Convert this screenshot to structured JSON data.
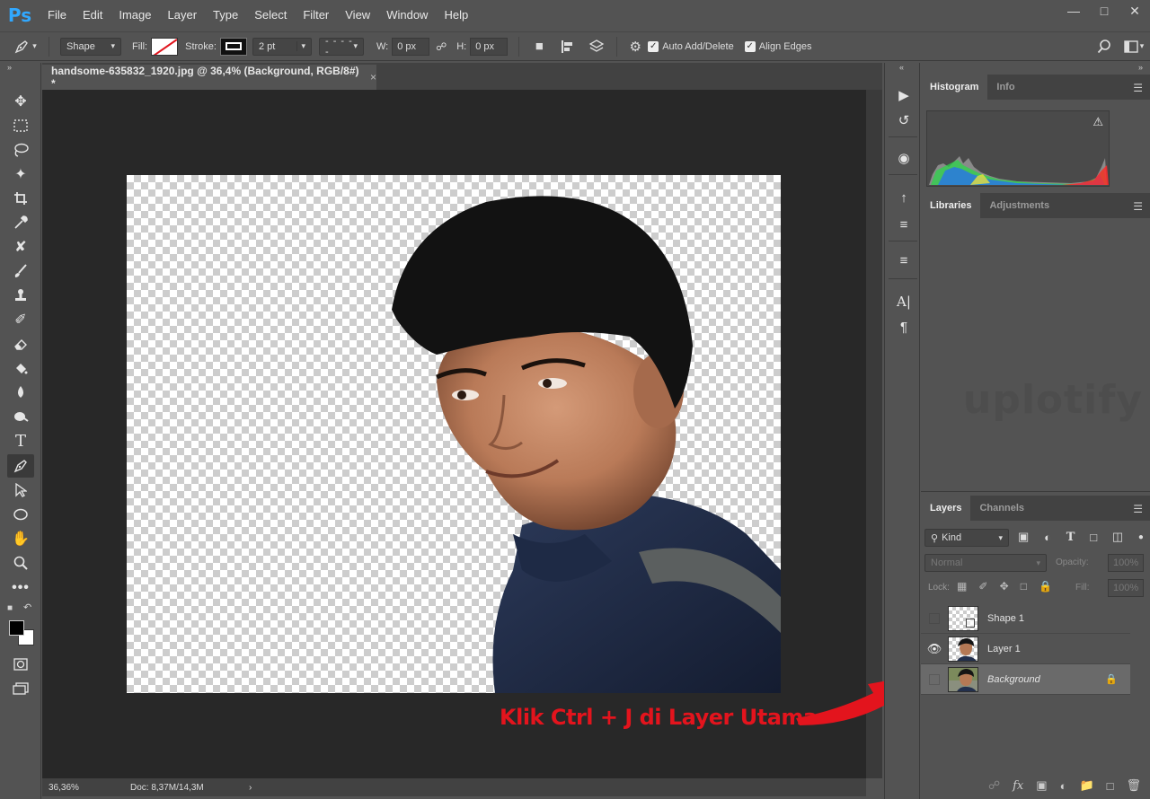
{
  "app": {
    "logo": "Ps"
  },
  "menu": [
    "File",
    "Edit",
    "Image",
    "Layer",
    "Type",
    "Select",
    "Filter",
    "View",
    "Window",
    "Help"
  ],
  "window_controls": [
    "minimize",
    "restore",
    "close"
  ],
  "options": {
    "mode": "Shape",
    "fill_label": "Fill:",
    "stroke_label": "Stroke:",
    "stroke_width": "2 pt",
    "w_label": "W:",
    "w_value": "0 px",
    "h_label": "H:",
    "h_value": "0 px",
    "auto_add_delete": "Auto Add/Delete",
    "align_edges": "Align Edges",
    "auto_add_checked": true,
    "align_edges_checked": true
  },
  "document": {
    "tab_title": "handsome-635832_1920.jpg @ 36,4% (Background, RGB/8#) *",
    "close": "×",
    "zoom": "36,36%",
    "doc_info": "Doc: 8,37M/14,3M",
    "status_arrow": "›"
  },
  "tools": [
    "move-tool",
    "marquee-tool",
    "lasso-tool",
    "magic-wand-tool",
    "crop-tool",
    "eyedropper-tool",
    "healing-brush-tool",
    "brush-tool",
    "clone-stamp-tool",
    "history-brush-tool",
    "eraser-tool",
    "paint-bucket-tool",
    "blur-tool",
    "dodge-tool",
    "type-tool",
    "pen-tool",
    "path-selection-tool",
    "ellipse-tool",
    "hand-tool",
    "zoom-tool",
    "more-tools"
  ],
  "panels": {
    "histogram_tabs": [
      "Histogram",
      "Info"
    ],
    "libraries_tabs": [
      "Libraries",
      "Adjustments"
    ],
    "layers_tabs": [
      "Layers",
      "Channels"
    ],
    "filter_kind": "Kind",
    "blend_mode": "Normal",
    "opacity_label": "Opacity:",
    "opacity_value": "100%",
    "lock_label": "Lock:",
    "fill_label": "Fill:",
    "fill_value": "100%",
    "watermark": "uplotify"
  },
  "layers": [
    {
      "name": "Shape 1",
      "visible": false,
      "selected": false,
      "locked": false
    },
    {
      "name": "Layer 1",
      "visible": true,
      "selected": false,
      "locked": false
    },
    {
      "name": "Background",
      "visible": false,
      "selected": true,
      "locked": true
    }
  ],
  "annotation": {
    "text": "Klik Ctrl + J di Layer Utama",
    "color": "#e3141d"
  },
  "colors": {
    "accent": "#31a8ff",
    "panel_bg": "#535353",
    "canvas_bg": "#282828"
  }
}
